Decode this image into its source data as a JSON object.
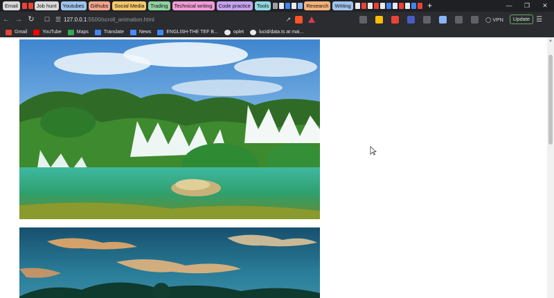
{
  "browser": {
    "tab_groups": [
      {
        "label": "Email",
        "color": "#d9d9d9"
      },
      {
        "label": "Job hunt",
        "color": "#d9d9d9"
      },
      {
        "label": "Youtubes",
        "color": "#9ec3ec"
      },
      {
        "label": "Githubs",
        "color": "#f2a48c"
      },
      {
        "label": "Social Media",
        "color": "#f6c86a"
      },
      {
        "label": "Trading",
        "color": "#8fd19e"
      },
      {
        "label": "Technical writing",
        "color": "#f29ad6"
      },
      {
        "label": "Code practice",
        "color": "#c7a2f0"
      },
      {
        "label": "Tools",
        "color": "#8ed7df"
      },
      {
        "label": "Research",
        "color": "#f6b27a"
      },
      {
        "label": "Writing",
        "color": "#9ec3ec"
      }
    ],
    "new_tab_label": "+",
    "window_controls": {
      "minimize": "—",
      "restore": "❐",
      "close": "✕"
    },
    "address": {
      "host": "127.0.0.1",
      "path": ":5500/scroll_animation.html"
    },
    "vpn_label": "VPN",
    "update_label": "Update"
  },
  "bookmarks": [
    {
      "label": "Gmail",
      "icon": "gmail-icon",
      "color": "#ea4335"
    },
    {
      "label": "YouTube",
      "icon": "youtube-icon",
      "color": "#ff0000"
    },
    {
      "label": "Maps",
      "icon": "maps-icon",
      "color": "#34a853"
    },
    {
      "label": "Translate",
      "icon": "translate-icon",
      "color": "#4285f4"
    },
    {
      "label": "News",
      "icon": "news-icon",
      "color": "#4c8bf5"
    },
    {
      "label": "ENGLISH-THE TEF B...",
      "icon": "doc-icon",
      "color": "#4285f4"
    },
    {
      "label": "oplet",
      "icon": "github-icon",
      "color": "#e8e8e8"
    },
    {
      "label": "lucid/data.ts at mai...",
      "icon": "github-icon",
      "color": "#e8e8e8"
    }
  ],
  "page": {
    "images": [
      {
        "name": "waterfall-photo",
        "alt": "Waterfall photo"
      },
      {
        "name": "sunset-sky-photo",
        "alt": "Sunset sky photo"
      }
    ]
  }
}
